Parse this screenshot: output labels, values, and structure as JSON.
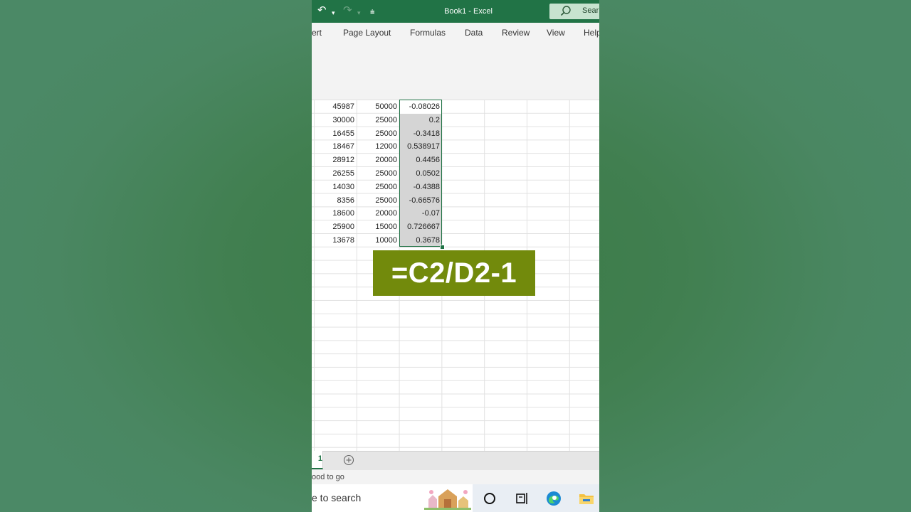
{
  "window": {
    "title": "Book1  -  Excel",
    "search_label": "Search",
    "search_visible": "Sear",
    "undo_icon": "undo-icon",
    "redo_icon": "redo-icon"
  },
  "ribbon": {
    "tabs": [
      "ert",
      "Page Layout",
      "Formulas",
      "Data",
      "Review",
      "View",
      "Help"
    ]
  },
  "sheet": {
    "rows": [
      [
        "45987",
        "50000",
        "-0.08026"
      ],
      [
        "30000",
        "25000",
        "0.2"
      ],
      [
        "16455",
        "25000",
        "-0.3418"
      ],
      [
        "18467",
        "12000",
        "0.538917"
      ],
      [
        "28912",
        "20000",
        "0.4456"
      ],
      [
        "26255",
        "25000",
        "0.0502"
      ],
      [
        "14030",
        "25000",
        "-0.4388"
      ],
      [
        "8356",
        "25000",
        "-0.66576"
      ],
      [
        "18600",
        "20000",
        "-0.07"
      ],
      [
        "25900",
        "15000",
        "0.726667"
      ],
      [
        "13678",
        "10000",
        "0.3678"
      ]
    ],
    "sheet_tab_label": "1",
    "add_sheet_icon": "plus-circle-icon"
  },
  "overlay": {
    "formula": "=C2/D2-1"
  },
  "status": {
    "text": "ood to go"
  },
  "taskbar": {
    "search_placeholder": "e to search",
    "icons": [
      "cortana-icon",
      "task-view-icon",
      "edge-icon",
      "file-explorer-icon"
    ]
  },
  "colors": {
    "excel_green": "#217346",
    "overlay_bg": "#728a0c",
    "selection_fill": "#d5d5d5"
  }
}
